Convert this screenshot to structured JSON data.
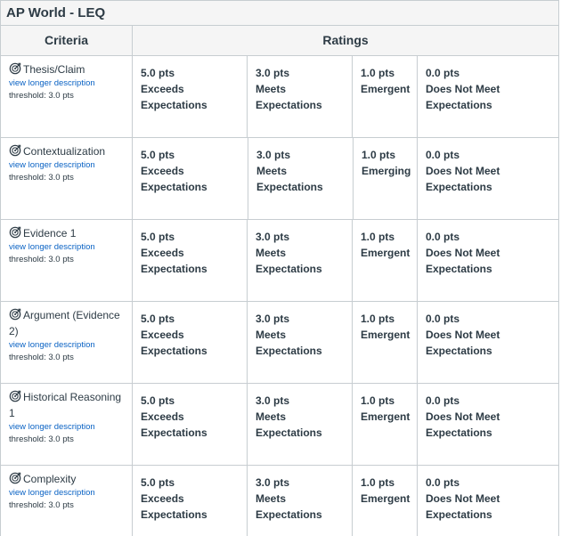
{
  "title": "AP World - LEQ",
  "headers": {
    "criteria": "Criteria",
    "ratings": "Ratings"
  },
  "link_label": "view longer description",
  "rows": [
    {
      "name": "Thesis/Claim",
      "threshold": "threshold: 3.0 pts",
      "ratings": [
        {
          "pts": "5.0 pts",
          "desc": "Exceeds Expectations"
        },
        {
          "pts": "3.0 pts",
          "desc": "Meets Expectations"
        },
        {
          "pts": "1.0 pts",
          "desc": "Emergent"
        },
        {
          "pts": "0.0 pts",
          "desc": "Does Not Meet Expectations"
        }
      ]
    },
    {
      "name": "Contextualization",
      "threshold": "threshold: 3.0 pts",
      "ratings": [
        {
          "pts": "5.0 pts",
          "desc": "Exceeds Expectations"
        },
        {
          "pts": "3.0 pts",
          "desc": "Meets Expectations"
        },
        {
          "pts": "1.0 pts",
          "desc": "Emerging"
        },
        {
          "pts": "0.0 pts",
          "desc": "Does Not Meet Expectations"
        }
      ]
    },
    {
      "name": "Evidence 1",
      "threshold": "threshold: 3.0 pts",
      "ratings": [
        {
          "pts": "5.0 pts",
          "desc": "Exceeds Expectations"
        },
        {
          "pts": "3.0 pts",
          "desc": "Meets Expectations"
        },
        {
          "pts": "1.0 pts",
          "desc": "Emergent"
        },
        {
          "pts": "0.0 pts",
          "desc": "Does Not Meet Expectations"
        }
      ]
    },
    {
      "name": "Argument (Evidence 2)",
      "threshold": "threshold: 3.0 pts",
      "ratings": [
        {
          "pts": "5.0 pts",
          "desc": "Exceeds Expectations"
        },
        {
          "pts": "3.0 pts",
          "desc": "Meets Expectations"
        },
        {
          "pts": "1.0 pts",
          "desc": "Emergent"
        },
        {
          "pts": "0.0 pts",
          "desc": "Does Not Meet Expectations"
        }
      ]
    },
    {
      "name": "Historical Reasoning 1",
      "threshold": "threshold: 3.0 pts",
      "ratings": [
        {
          "pts": "5.0 pts",
          "desc": "Exceeds Expectations"
        },
        {
          "pts": "3.0 pts",
          "desc": "Meets Expectations"
        },
        {
          "pts": "1.0 pts",
          "desc": "Emergent"
        },
        {
          "pts": "0.0 pts",
          "desc": "Does Not Meet Expectations"
        }
      ]
    },
    {
      "name": "Complexity",
      "threshold": "threshold: 3.0 pts",
      "ratings": [
        {
          "pts": "5.0 pts",
          "desc": "Exceeds Expectations"
        },
        {
          "pts": "3.0 pts",
          "desc": "Meets Expectations"
        },
        {
          "pts": "1.0 pts",
          "desc": "Emergent"
        },
        {
          "pts": "0.0 pts",
          "desc": "Does Not Meet Expectations"
        }
      ]
    }
  ]
}
